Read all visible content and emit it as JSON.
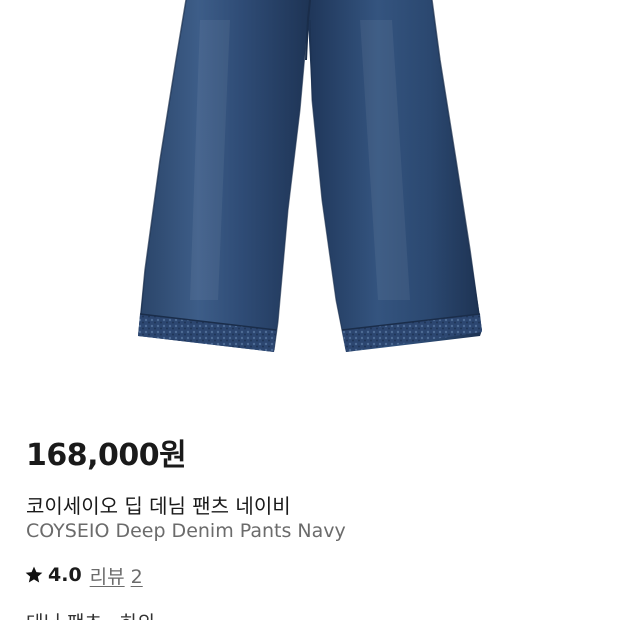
{
  "product": {
    "price": "168,000원",
    "title_ko": "코이세이오 딥 데님 팬츠 네이비",
    "title_en": "COYSEIO Deep Denim Pants Navy",
    "rating": "4.0",
    "review_label": "리뷰",
    "review_count": "2",
    "category": "데님 팬츠 · 하의"
  },
  "icons": {
    "rating_star": "star-icon"
  },
  "colors": {
    "denim_dark": "#1f3556",
    "denim_mid": "#2e4a73",
    "denim_light": "#4a6a95",
    "star": "#111111",
    "price_text": "#1a1a1a",
    "muted_text": "#6b6b6b"
  }
}
